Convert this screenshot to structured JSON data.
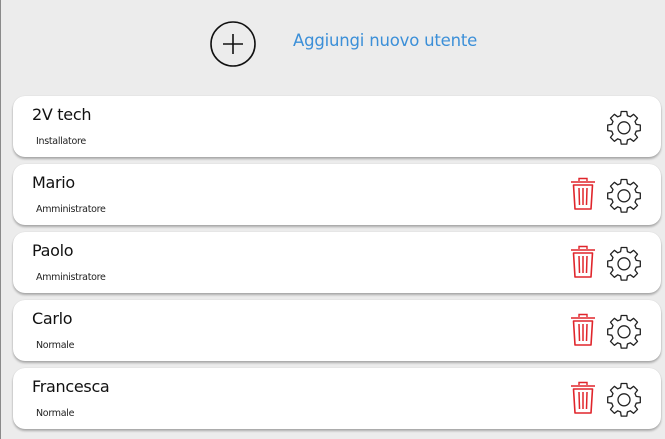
{
  "add_user": {
    "label": "Aggiungi nuovo utente",
    "icon": "plus-circle-icon"
  },
  "colors": {
    "accent": "#3b8fd8",
    "delete": "#e0252b",
    "background": "#ececec",
    "card": "#ffffff"
  },
  "users": [
    {
      "name": "2V tech",
      "role": "Installatore",
      "deletable": false
    },
    {
      "name": "Mario",
      "role": "Amministratore",
      "deletable": true
    },
    {
      "name": "Paolo",
      "role": "Amministratore",
      "deletable": true
    },
    {
      "name": "Carlo",
      "role": "Normale",
      "deletable": true
    },
    {
      "name": "Francesca",
      "role": "Normale",
      "deletable": true
    }
  ]
}
